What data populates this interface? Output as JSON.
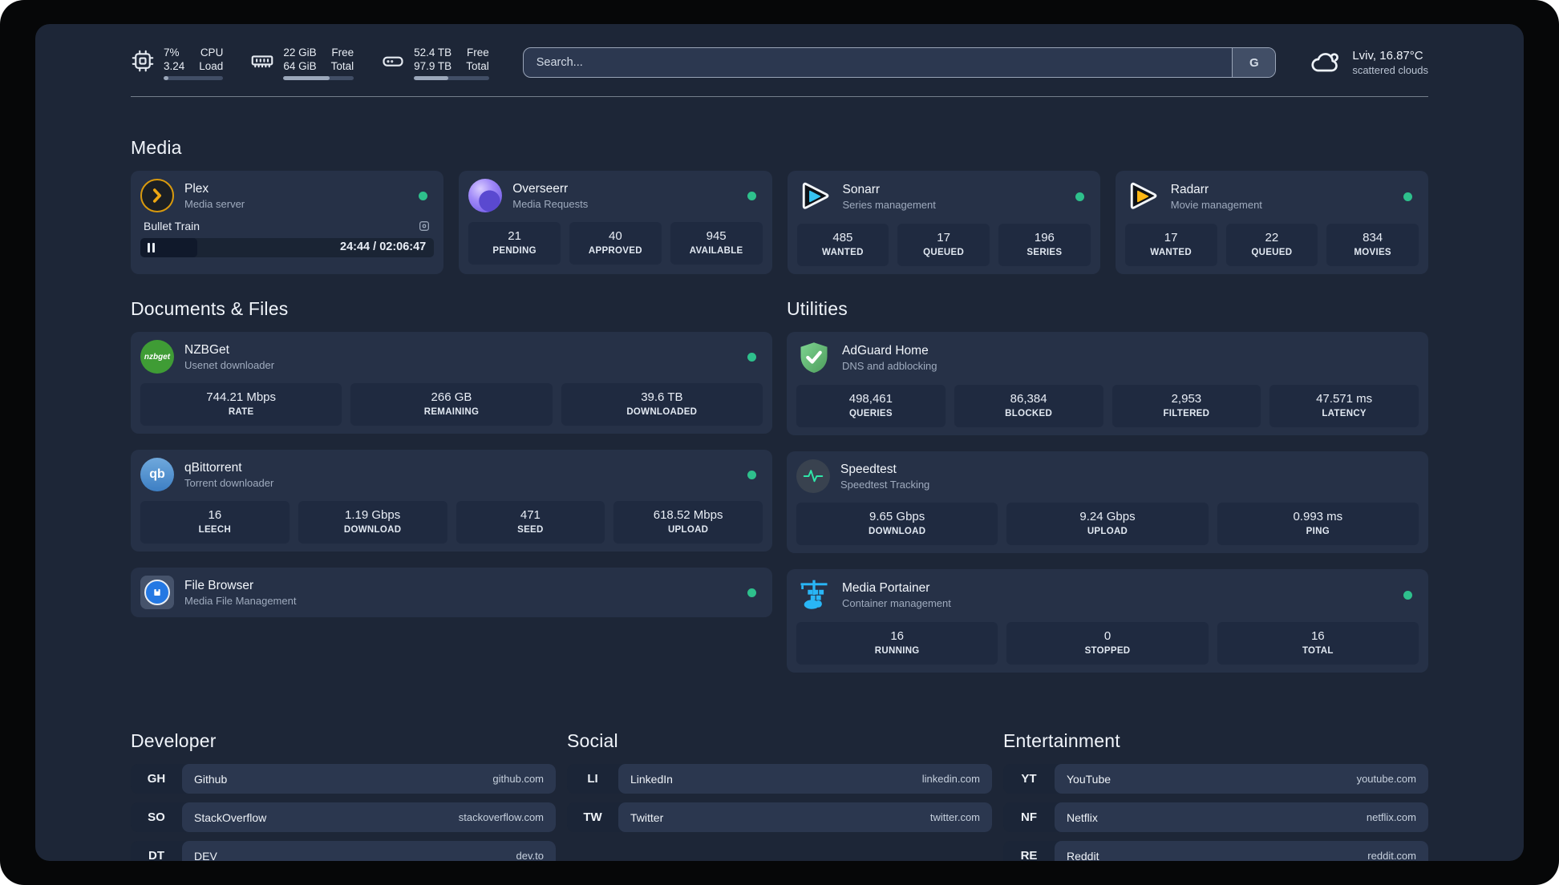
{
  "header": {
    "resources": [
      {
        "name": "cpu",
        "values": [
          "7%",
          "3.24"
        ],
        "labels": [
          "CPU",
          "Load"
        ],
        "percent": 8
      },
      {
        "name": "memory",
        "values": [
          "22 GiB",
          "64 GiB"
        ],
        "labels": [
          "Free",
          "Total"
        ],
        "percent": 66
      },
      {
        "name": "disk",
        "values": [
          "52.4 TB",
          "97.9 TB"
        ],
        "labels": [
          "Free",
          "Total"
        ],
        "percent": 46
      }
    ],
    "search": {
      "placeholder": "Search...",
      "provider_button": "G"
    },
    "weather": {
      "location_temp": "Lviv, 16.87°C",
      "condition": "scattered clouds"
    }
  },
  "status_color": "#2ec08c",
  "sections": {
    "media": {
      "title": "Media",
      "plex": {
        "name": "Plex",
        "description": "Media server",
        "online": true,
        "now_playing": {
          "title": "Bullet Train",
          "state": "paused",
          "time_display": "24:44 / 02:06:47",
          "progress_percent": 19.5
        }
      },
      "overseerr": {
        "name": "Overseerr",
        "description": "Media Requests",
        "online": true,
        "stats": [
          {
            "value": "21",
            "label": "PENDING"
          },
          {
            "value": "40",
            "label": "APPROVED"
          },
          {
            "value": "945",
            "label": "AVAILABLE"
          }
        ]
      },
      "sonarr": {
        "name": "Sonarr",
        "description": "Series management",
        "online": true,
        "stats": [
          {
            "value": "485",
            "label": "WANTED"
          },
          {
            "value": "17",
            "label": "QUEUED"
          },
          {
            "value": "196",
            "label": "SERIES"
          }
        ]
      },
      "radarr": {
        "name": "Radarr",
        "description": "Movie management",
        "online": true,
        "stats": [
          {
            "value": "17",
            "label": "WANTED"
          },
          {
            "value": "22",
            "label": "QUEUED"
          },
          {
            "value": "834",
            "label": "MOVIES"
          }
        ]
      }
    },
    "documents": {
      "title": "Documents & Files",
      "nzbget": {
        "name": "NZBGet",
        "description": "Usenet downloader",
        "online": true,
        "stats": [
          {
            "value": "744.21 Mbps",
            "label": "RATE"
          },
          {
            "value": "266 GB",
            "label": "REMAINING"
          },
          {
            "value": "39.6 TB",
            "label": "DOWNLOADED"
          }
        ]
      },
      "qbittorrent": {
        "name": "qBittorrent",
        "description": "Torrent downloader",
        "online": true,
        "stats": [
          {
            "value": "16",
            "label": "LEECH"
          },
          {
            "value": "1.19 Gbps",
            "label": "DOWNLOAD"
          },
          {
            "value": "471",
            "label": "SEED"
          },
          {
            "value": "618.52 Mbps",
            "label": "UPLOAD"
          }
        ]
      },
      "filebrowser": {
        "name": "File Browser",
        "description": "Media File Management",
        "online": true
      }
    },
    "utilities": {
      "title": "Utilities",
      "adguard": {
        "name": "AdGuard Home",
        "description": "DNS and adblocking",
        "stats": [
          {
            "value": "498,461",
            "label": "QUERIES"
          },
          {
            "value": "86,384",
            "label": "BLOCKED"
          },
          {
            "value": "2,953",
            "label": "FILTERED"
          },
          {
            "value": "47.571 ms",
            "label": "LATENCY"
          }
        ]
      },
      "speedtest": {
        "name": "Speedtest",
        "description": "Speedtest Tracking",
        "stats": [
          {
            "value": "9.65 Gbps",
            "label": "DOWNLOAD"
          },
          {
            "value": "9.24 Gbps",
            "label": "UPLOAD"
          },
          {
            "value": "0.993 ms",
            "label": "PING"
          }
        ]
      },
      "portainer": {
        "name": "Media Portainer",
        "description": "Container management",
        "online": true,
        "stats": [
          {
            "value": "16",
            "label": "RUNNING"
          },
          {
            "value": "0",
            "label": "STOPPED"
          },
          {
            "value": "16",
            "label": "TOTAL"
          }
        ]
      }
    }
  },
  "bookmarks": {
    "developer": {
      "title": "Developer",
      "items": [
        {
          "abbr": "GH",
          "label": "Github",
          "href": "github.com"
        },
        {
          "abbr": "SO",
          "label": "StackOverflow",
          "href": "stackoverflow.com"
        },
        {
          "abbr": "DT",
          "label": "DEV",
          "href": "dev.to"
        }
      ]
    },
    "social": {
      "title": "Social",
      "items": [
        {
          "abbr": "LI",
          "label": "LinkedIn",
          "href": "linkedin.com"
        },
        {
          "abbr": "TW",
          "label": "Twitter",
          "href": "twitter.com"
        }
      ]
    },
    "entertainment": {
      "title": "Entertainment",
      "items": [
        {
          "abbr": "YT",
          "label": "YouTube",
          "href": "youtube.com"
        },
        {
          "abbr": "NF",
          "label": "Netflix",
          "href": "netflix.com"
        },
        {
          "abbr": "RE",
          "label": "Reddit",
          "href": "reddit.com"
        }
      ]
    }
  }
}
